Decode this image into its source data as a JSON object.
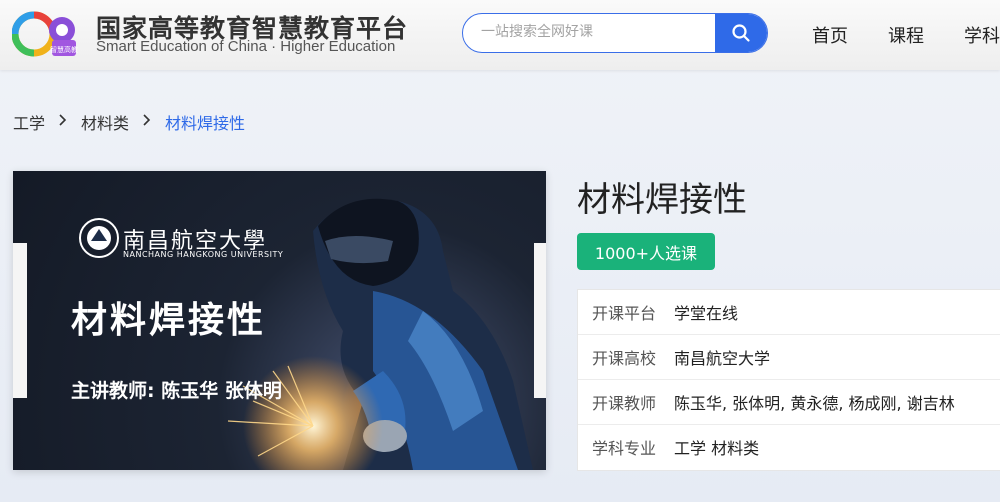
{
  "header": {
    "logo_title": "国家高等教育智慧教育平台",
    "logo_subtitle": "Smart Education of China · Higher Education",
    "logo_badge_text": "智慧高教",
    "search_placeholder": "一站搜索全网好课",
    "nav": [
      {
        "label": "首页"
      },
      {
        "label": "课程"
      },
      {
        "label": "学科"
      }
    ]
  },
  "breadcrumb": {
    "items": [
      "工学",
      "材料类"
    ],
    "current": "材料焊接性"
  },
  "cover": {
    "university_cn": "南昌航空大學",
    "university_en": "NANCHANG HANGKONG UNIVERSITY",
    "title": "材料焊接性",
    "teachers": "主讲教师: 陈玉华  张体明"
  },
  "course": {
    "title": "材料焊接性",
    "enroll_badge": "1000+人选课",
    "info": [
      {
        "label": "开课平台",
        "value": "学堂在线"
      },
      {
        "label": "开课高校",
        "value": "南昌航空大学"
      },
      {
        "label": "开课教师",
        "value": "陈玉华, 张体明, 黄永德, 杨成刚, 谢吉林"
      },
      {
        "label": "学科专业",
        "value": "工学 材料类"
      }
    ]
  },
  "colors": {
    "accent_blue": "#2f6ae8",
    "enroll_green": "#1ab27a"
  },
  "icons": {
    "search": "search-icon",
    "breadcrumb_separator": "chevron-right-icon",
    "logo": "smart-education-logo-icon"
  }
}
